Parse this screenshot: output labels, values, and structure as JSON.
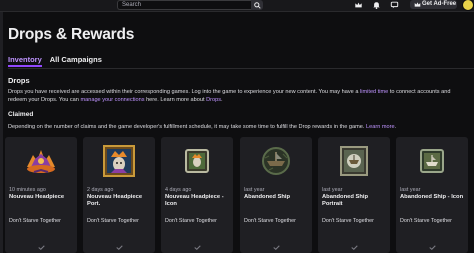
{
  "topbar": {
    "search_placeholder": "Search",
    "ad_free_label": "Get Ad-Free"
  },
  "page": {
    "title": "Drops & Rewards",
    "tabs": [
      {
        "label": "Inventory",
        "active": true
      },
      {
        "label": "All Campaigns",
        "active": false
      }
    ]
  },
  "drops": {
    "heading": "Drops",
    "desc_part1": "Drops you have received are accessed within their corresponding games. Log into the game to experience your new content. You may have a ",
    "limited_time_link": "limited time",
    "desc_part2": " to connect accounts and redeem your Drops. You can ",
    "manage_link": "manage your connections",
    "desc_part3": " here. Learn more about ",
    "drops_link": "Drops",
    "desc_part4": "."
  },
  "claimed": {
    "heading": "Claimed",
    "desc": "Depending on the number of claims and the game developer's fulfillment schedule, it may take some time to fulfill the Drop rewards in the game. ",
    "learn_more": "Learn more",
    "desc_end": "."
  },
  "items": [
    {
      "time": "10 minutes ago",
      "name": "Nouveau Headpiece",
      "game": "Don't Starve Together",
      "icon": "headpiece-icon"
    },
    {
      "time": "2 days ago",
      "name": "Nouveau Headpiece Port.",
      "game": "Don't Starve Together",
      "icon": "headpiece-portrait-icon"
    },
    {
      "time": "4 days ago",
      "name": "Nouveau Headpiece - Icon",
      "game": "Don't Starve Together",
      "icon": "headpiece-framed-icon"
    },
    {
      "time": "last year",
      "name": "Abandoned Ship",
      "game": "Don't Starve Together",
      "icon": "ship-icon"
    },
    {
      "time": "last year",
      "name": "Abandoned Ship Portrait",
      "game": "Don't Starve Together",
      "icon": "ship-portrait-icon"
    },
    {
      "time": "last year",
      "name": "Abandoned Ship - Icon",
      "game": "Don't Starve Together",
      "icon": "ship-framed-icon"
    }
  ],
  "colors": {
    "background": "#0e0e10",
    "card": "#1f1f23",
    "accent": "#bf94ff",
    "tab_underline": "#9147ff",
    "avatar": "#e8d24a"
  }
}
